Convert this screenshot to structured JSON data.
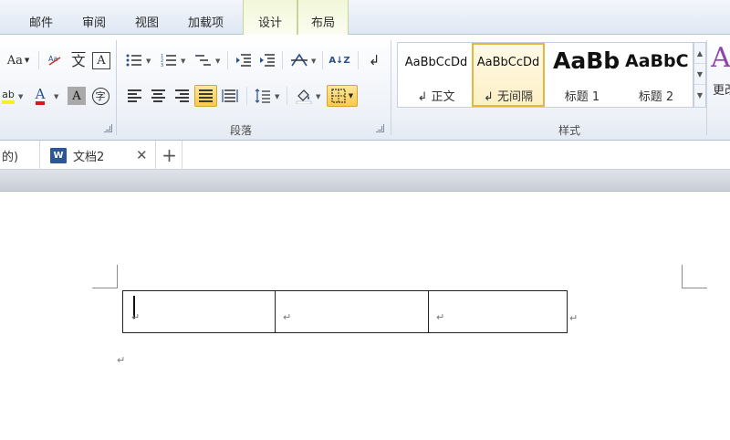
{
  "ribbon_tabs": {
    "mailings": "邮件",
    "review": "审阅",
    "view": "视图",
    "addins": "加载项",
    "design": "设计",
    "layout": "布局"
  },
  "font_group": {
    "change_case": "Aa",
    "pinyin": "文",
    "border_char": "A",
    "highlight": "ab",
    "font_color": "A",
    "char_shading": "A",
    "enclose_char": "字",
    "font_color_hex": "#d8191d",
    "highlight_hex": "#f5ef2b"
  },
  "paragraph_group": {
    "label": "段落",
    "sort_az": "A↓Z",
    "show_marks": "↲"
  },
  "styles_group": {
    "label": "样式",
    "change_styles": "更改",
    "items": [
      {
        "preview": "AaBbCcDd",
        "name": "↲ 正文"
      },
      {
        "preview": "AaBbCcDd",
        "name": "↲ 无间隔"
      },
      {
        "preview": "AaBb",
        "name": "标题 1"
      },
      {
        "preview": "AaBbC",
        "name": "标题 2"
      }
    ]
  },
  "doc_tabs": {
    "prev_suffix": "的)",
    "current": "文档2",
    "word_badge": "W",
    "close": "✕",
    "add": "+"
  },
  "document": {
    "para_mark": "↵"
  }
}
